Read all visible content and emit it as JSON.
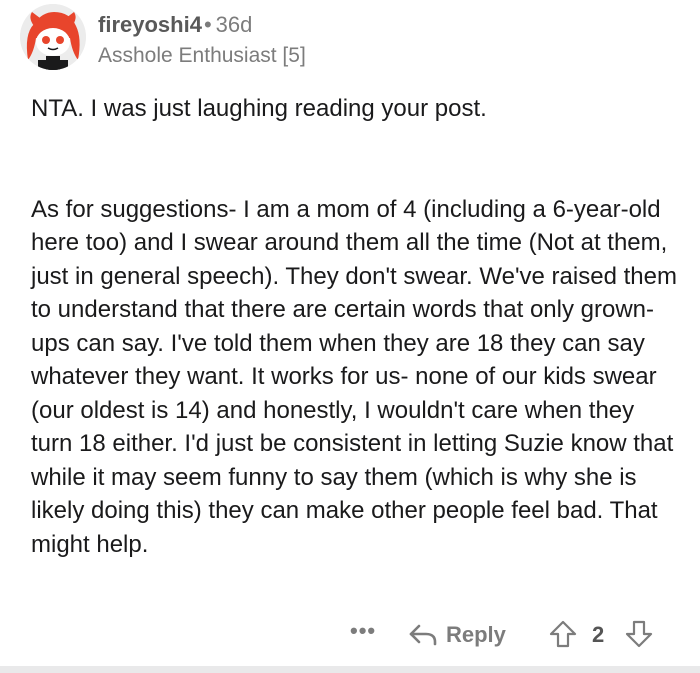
{
  "comment": {
    "username": "fireyoshi4",
    "separator": "•",
    "age": "36d",
    "flair": "Asshole Enthusiast [5]",
    "avatar_icon": "snoo-avatar-icon",
    "body": {
      "p1": "NTA. I was just laughing reading your post.",
      "p2": "As for suggestions- I am a mom of 4 (including a 6-year-old here too) and I swear around them all the time (Not at them, just in general speech). They don't swear. We've raised them to understand that there are certain words that only grown-ups can say. I've told them when they are 18 they can say whatever they want. It works for us- none of our kids swear (our oldest is 14) and honestly, I wouldn't care when they turn 18 either. I'd just be consistent in letting Suzie know that while it may seem funny to say them (which is why she is likely doing this) they can make other people feel bad. That might help."
    }
  },
  "actions": {
    "more_label": "•••",
    "reply_label": "Reply",
    "score": "2"
  },
  "colors": {
    "text": "#1a1a1b",
    "meta": "#7c7c7c",
    "avatar_hair": "#e8452c"
  }
}
